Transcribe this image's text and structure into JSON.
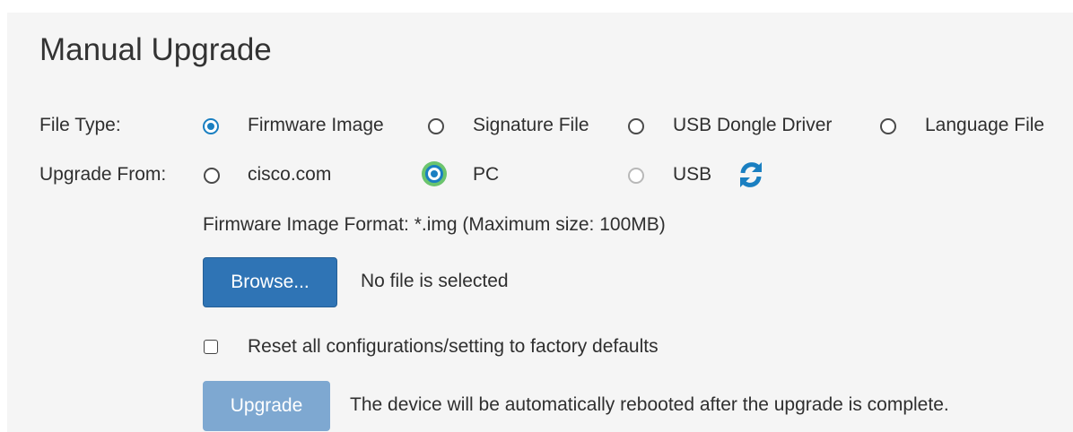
{
  "title": "Manual Upgrade",
  "file_type": {
    "label": "File Type:",
    "options": [
      "Firmware Image",
      "Signature File",
      "USB Dongle Driver",
      "Language File"
    ],
    "selected": "Firmware Image"
  },
  "upgrade_from": {
    "label": "Upgrade From:",
    "options": [
      "cisco.com",
      "PC",
      "USB"
    ],
    "selected": "PC",
    "disabled": [
      "USB"
    ]
  },
  "format_note": "Firmware Image Format: *.img (Maximum size: 100MB)",
  "browse": {
    "button_label": "Browse...",
    "status": "No file is selected"
  },
  "reset_checkbox_label": "Reset all configurations/setting to factory defaults",
  "upgrade": {
    "button_label": "Upgrade",
    "note": "The device will be automatically rebooted after the upgrade is complete."
  },
  "colors": {
    "accent": "#1a7fc1",
    "focus_ring": "#6bc46d",
    "primary_button": "#2f74b5",
    "disabled_button": "#7ea8d1"
  },
  "icons": {
    "refresh": "refresh-icon"
  }
}
